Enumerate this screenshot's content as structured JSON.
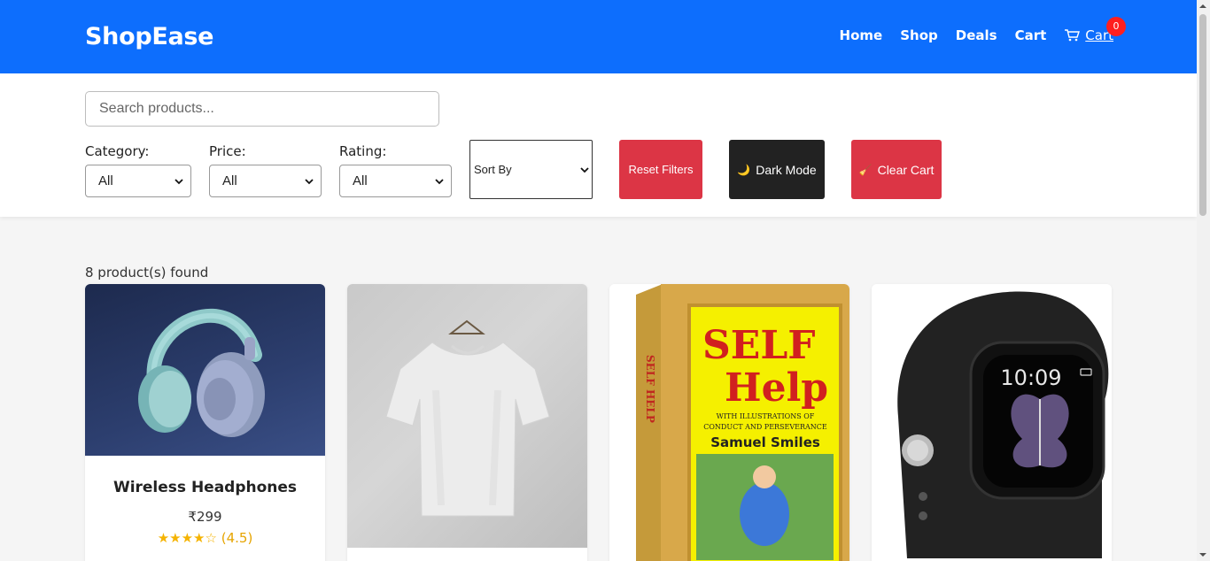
{
  "brand": "ShopEase",
  "nav": {
    "home": "Home",
    "shop": "Shop",
    "deals": "Deals",
    "cart": "Cart",
    "cart_link": "Cart",
    "cart_count": "0"
  },
  "search": {
    "placeholder": "Search products..."
  },
  "filters": {
    "category": {
      "label": "Category:",
      "value": "All"
    },
    "price": {
      "label": "Price:",
      "value": "All"
    },
    "rating": {
      "label": "Rating:",
      "value": "All"
    },
    "sort": {
      "value": "Sort By"
    }
  },
  "buttons": {
    "reset": "Reset Filters",
    "dark_mode": "Dark Mode",
    "clear_cart": "Clear Cart"
  },
  "results_count": "8 product(s) found",
  "products": [
    {
      "title": "Wireless Headphones",
      "price": "₹299",
      "stars": "★★★★☆",
      "rating": "(4.5)",
      "rating_value": 4.5,
      "image_icon": "headphones-icon"
    },
    {
      "image_icon": "tshirt-icon"
    },
    {
      "image_icon": "book-cover-icon",
      "book_lines": [
        "SELF",
        "Help",
        "WITH ILLUSTRATIONS OF",
        "CONDUCT AND PERSEVERANCE",
        "Samuel Smiles",
        "SELF HELP"
      ]
    },
    {
      "image_icon": "smartwatch-icon",
      "watch_time": "10:09"
    }
  ],
  "colors": {
    "primary": "#0d6efd",
    "danger": "#dc3545",
    "dark": "#222222",
    "badge": "#ff1f1f",
    "star": "#f5b301"
  }
}
